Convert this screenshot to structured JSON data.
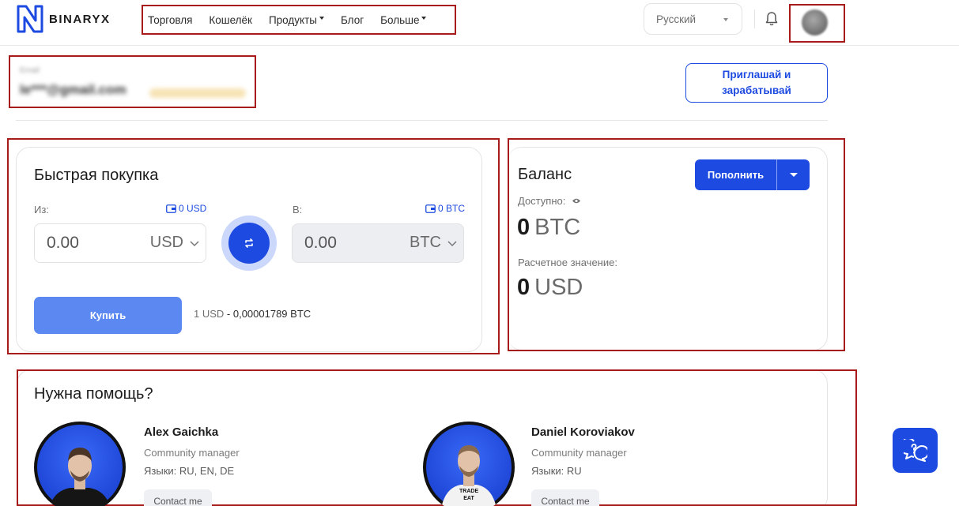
{
  "header": {
    "logo_text": "BINARYX",
    "nav": [
      {
        "label": "Торговля"
      },
      {
        "label": "Кошелёк"
      },
      {
        "label": "Продукты"
      },
      {
        "label": "Блог"
      },
      {
        "label": "Больше"
      }
    ],
    "language": "Русский"
  },
  "account": {
    "label": "Email",
    "email": "le***@gmail.com",
    "invite_label": "Приглашай и\nзарабатывай"
  },
  "quick_buy": {
    "title": "Быстрая покупка",
    "from_label": "Из:",
    "from_balance": "0 USD",
    "from_amount": "0.00",
    "from_currency": "USD",
    "to_label": "В:",
    "to_balance": "0 BTC",
    "to_amount": "0.00",
    "to_currency": "BTC",
    "buy_label": "Купить",
    "rate_left": "1 USD",
    "rate_sep": " - ",
    "rate_right": "0,00001789 BTC"
  },
  "balance": {
    "title": "Баланс",
    "deposit_label": "Пополнить",
    "available_label": "Доступно:",
    "available_value": "0",
    "available_currency": "BTC",
    "estimated_label": "Расчетное значение:",
    "estimated_value": "0",
    "estimated_currency": "USD"
  },
  "help": {
    "title": "Нужна помощь?",
    "managers": [
      {
        "name": "Alex Gaichka",
        "role": "Community manager",
        "languages": "Языки: RU, EN, DE",
        "contact_label": "Contact me"
      },
      {
        "name": "Daniel Koroviakov",
        "role": "Community manager",
        "languages": "Языки: RU",
        "contact_label": "Contact me",
        "shirt_text": "TRADE EAT"
      }
    ]
  },
  "colors": {
    "accent": "#1d4ae0",
    "buy_button": "#5c88f2",
    "annotation_outline": "#a81b1b"
  }
}
